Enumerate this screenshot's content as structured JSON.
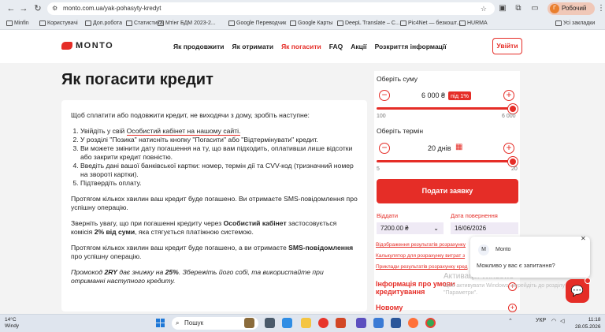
{
  "browser": {
    "url": "monto.com.ua/yak-pohasyty-kredyt",
    "profile_label": "Робочий",
    "profile_initial": "Г",
    "bookmarks": [
      "Minfin",
      "Користувачі",
      "Доп.робота",
      "Статистика",
      "Мтінг БДМ 2023-2...",
      "Google Переводчик",
      "Google Карты",
      "DeepL Translate – С...",
      "Pic4Net — безкошт...",
      "HURMA"
    ],
    "all_bookmarks": "Усі закладки"
  },
  "header": {
    "logo": "MONTO",
    "nav": [
      "Як продовжити",
      "Як отримати",
      "Як погасити",
      "FAQ",
      "Акції",
      "Розкриття інформації"
    ],
    "active_nav": "Як погасити",
    "login": "Увійти"
  },
  "page": {
    "title": "Як погасити кредит",
    "intro": "Щоб сплатити або подовжити кредит, не виходячи з дому, зробіть наступне:",
    "steps": {
      "s1_pre": "Увійдіть у свій ",
      "s1_link": "Особистий кабінет на нашому сайті.",
      "s2": "У розділі \"Позика\" натисніть кнопку \"Погасити\" або \"Відтермінувати\" кредит.",
      "s3": "Ви можете змінити дату погашення на ту, що вам підходить, оплативши лише відсотки або закрити кредит повністю.",
      "s4": "Введіть дані вашої банківської картки: номер, термін дії та CVV-код (тризначний номер на звороті картки).",
      "s5": "Підтвердіть оплату."
    },
    "p1": "Протягом кількох хвилин ваш кредит буде погашено. Ви отримаєте SMS-повідомлення про успішну операцію.",
    "p2_a": "Зверніть увагу, що при погашенні кредиту через ",
    "p2_b": "Особистий кабінет",
    "p2_c": " застосовується комісія ",
    "p2_d": "2% від суми",
    "p2_e": ", яка стягується платіжною системою.",
    "p3_a": "Протягом кількох хвилин ваш кредит буде погашено, а ви отримаєте ",
    "p3_b": "SMS-повідомлення",
    "p3_c": " про успішну операцію.",
    "p4_a": "Промокод ",
    "p4_b": "2RY",
    "p4_c": " дає знижку на ",
    "p4_d": "25%",
    "p4_e": ". Збережіть його собі, та використайте при отриманні наступного кредиту."
  },
  "calculator": {
    "sum_label": "Оберіть суму",
    "sum_value": "6 000 ₴",
    "sum_badge": "під 1%",
    "sum_min": "100",
    "sum_max": "6 000",
    "sum_fraction": 1.0,
    "term_label": "Оберіть термін",
    "term_value": "20 днів",
    "term_min": "5",
    "term_max": "20",
    "term_fraction": 1.0,
    "apply": "Подати заявку",
    "give_label": "Віддати",
    "give_value": "7200.00 ₴",
    "return_label": "Дата повернення",
    "return_value": "16/06/2026",
    "links": [
      "Відображення результатів розрахунку",
      "Калькулятор для розрахунку витрат з",
      "Приклади результатів розрахунку кред"
    ],
    "info_title": "Інформація про умови кредитування",
    "new_title": "Новому"
  },
  "chat": {
    "avatar": "M",
    "name": "Monto",
    "message": "Можливо у вас є запитання?"
  },
  "watermark": {
    "line1": "Активація Windows",
    "line2": "Щоб активувати Windows, перейдіть до розділу \"Параметри\"."
  },
  "taskbar": {
    "temp": "14°C",
    "weather": "Windy",
    "search": "Пошук",
    "lang": "УКР",
    "time": "11:18",
    "date": "28.05.2026"
  },
  "colors": {
    "accent": "#e52d27"
  }
}
